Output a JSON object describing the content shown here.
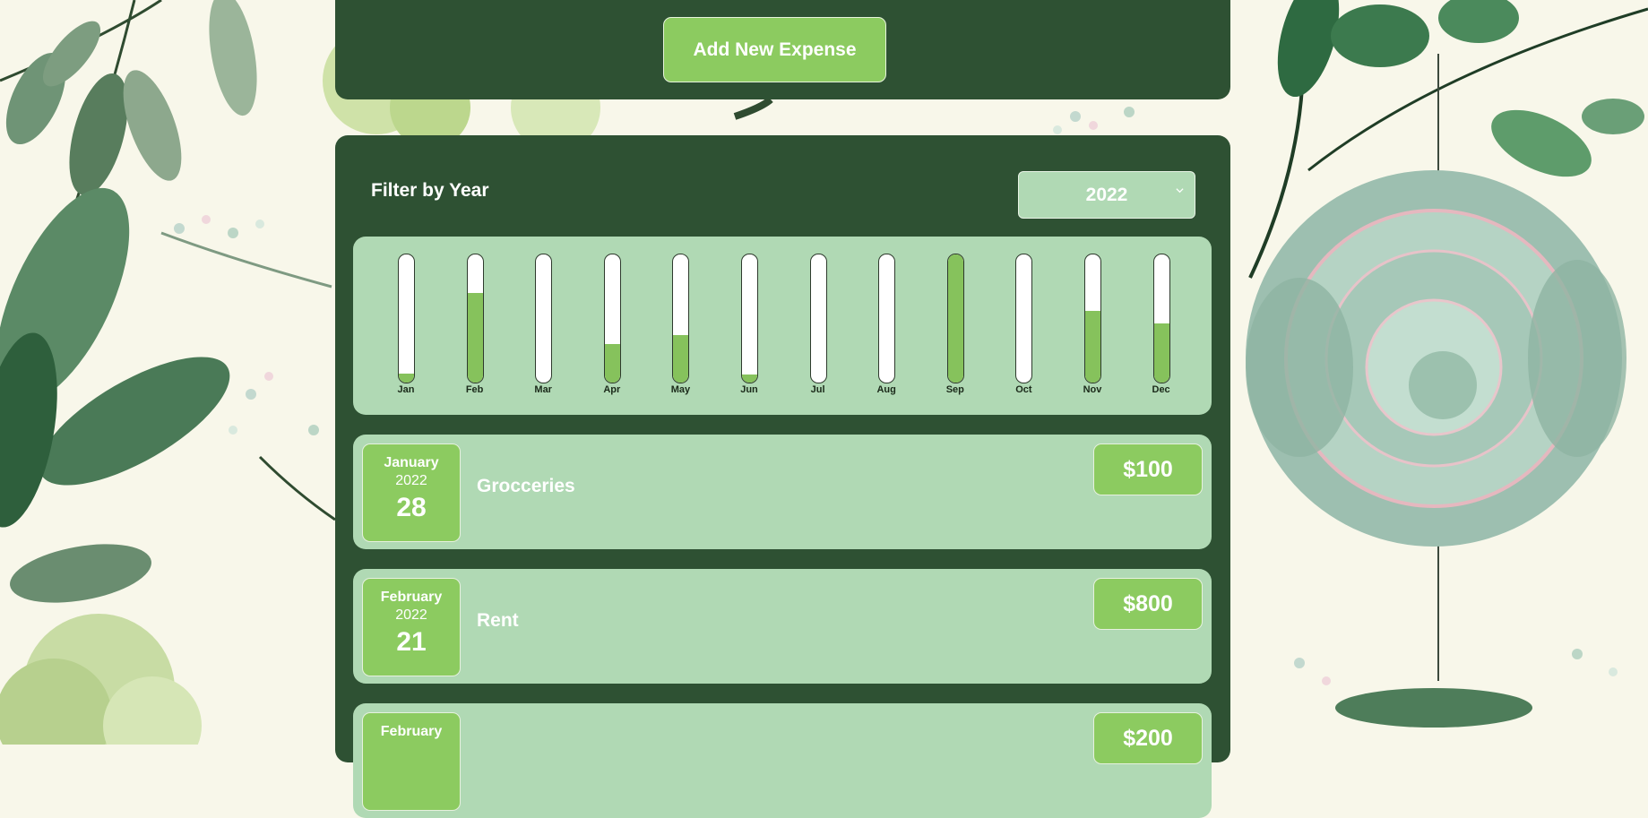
{
  "header": {
    "add_button_label": "Add New Expense"
  },
  "filter": {
    "label": "Filter by Year",
    "selected_year": "2022"
  },
  "chart_data": {
    "type": "bar",
    "categories": [
      "Jan",
      "Feb",
      "Mar",
      "Apr",
      "May",
      "Jun",
      "Jul",
      "Aug",
      "Sep",
      "Oct",
      "Nov",
      "Dec"
    ],
    "values": [
      0.07,
      0.7,
      0,
      0.3,
      0.37,
      0.06,
      0,
      0,
      1.0,
      0,
      0.56,
      0.46
    ],
    "ylim": [
      0,
      1
    ]
  },
  "expenses": [
    {
      "month": "January",
      "year": "2022",
      "day": "28",
      "title": "Grocceries",
      "amount": "$100"
    },
    {
      "month": "February",
      "year": "2022",
      "day": "21",
      "title": "Rent",
      "amount": "$800"
    },
    {
      "month": "February",
      "year": "",
      "day": "",
      "title": "",
      "amount": "$200"
    }
  ],
  "colors": {
    "panel": "#2e5133",
    "accent_green": "#8ccb60",
    "card_green": "#b0d9b4",
    "background": "#f8f7ea"
  }
}
